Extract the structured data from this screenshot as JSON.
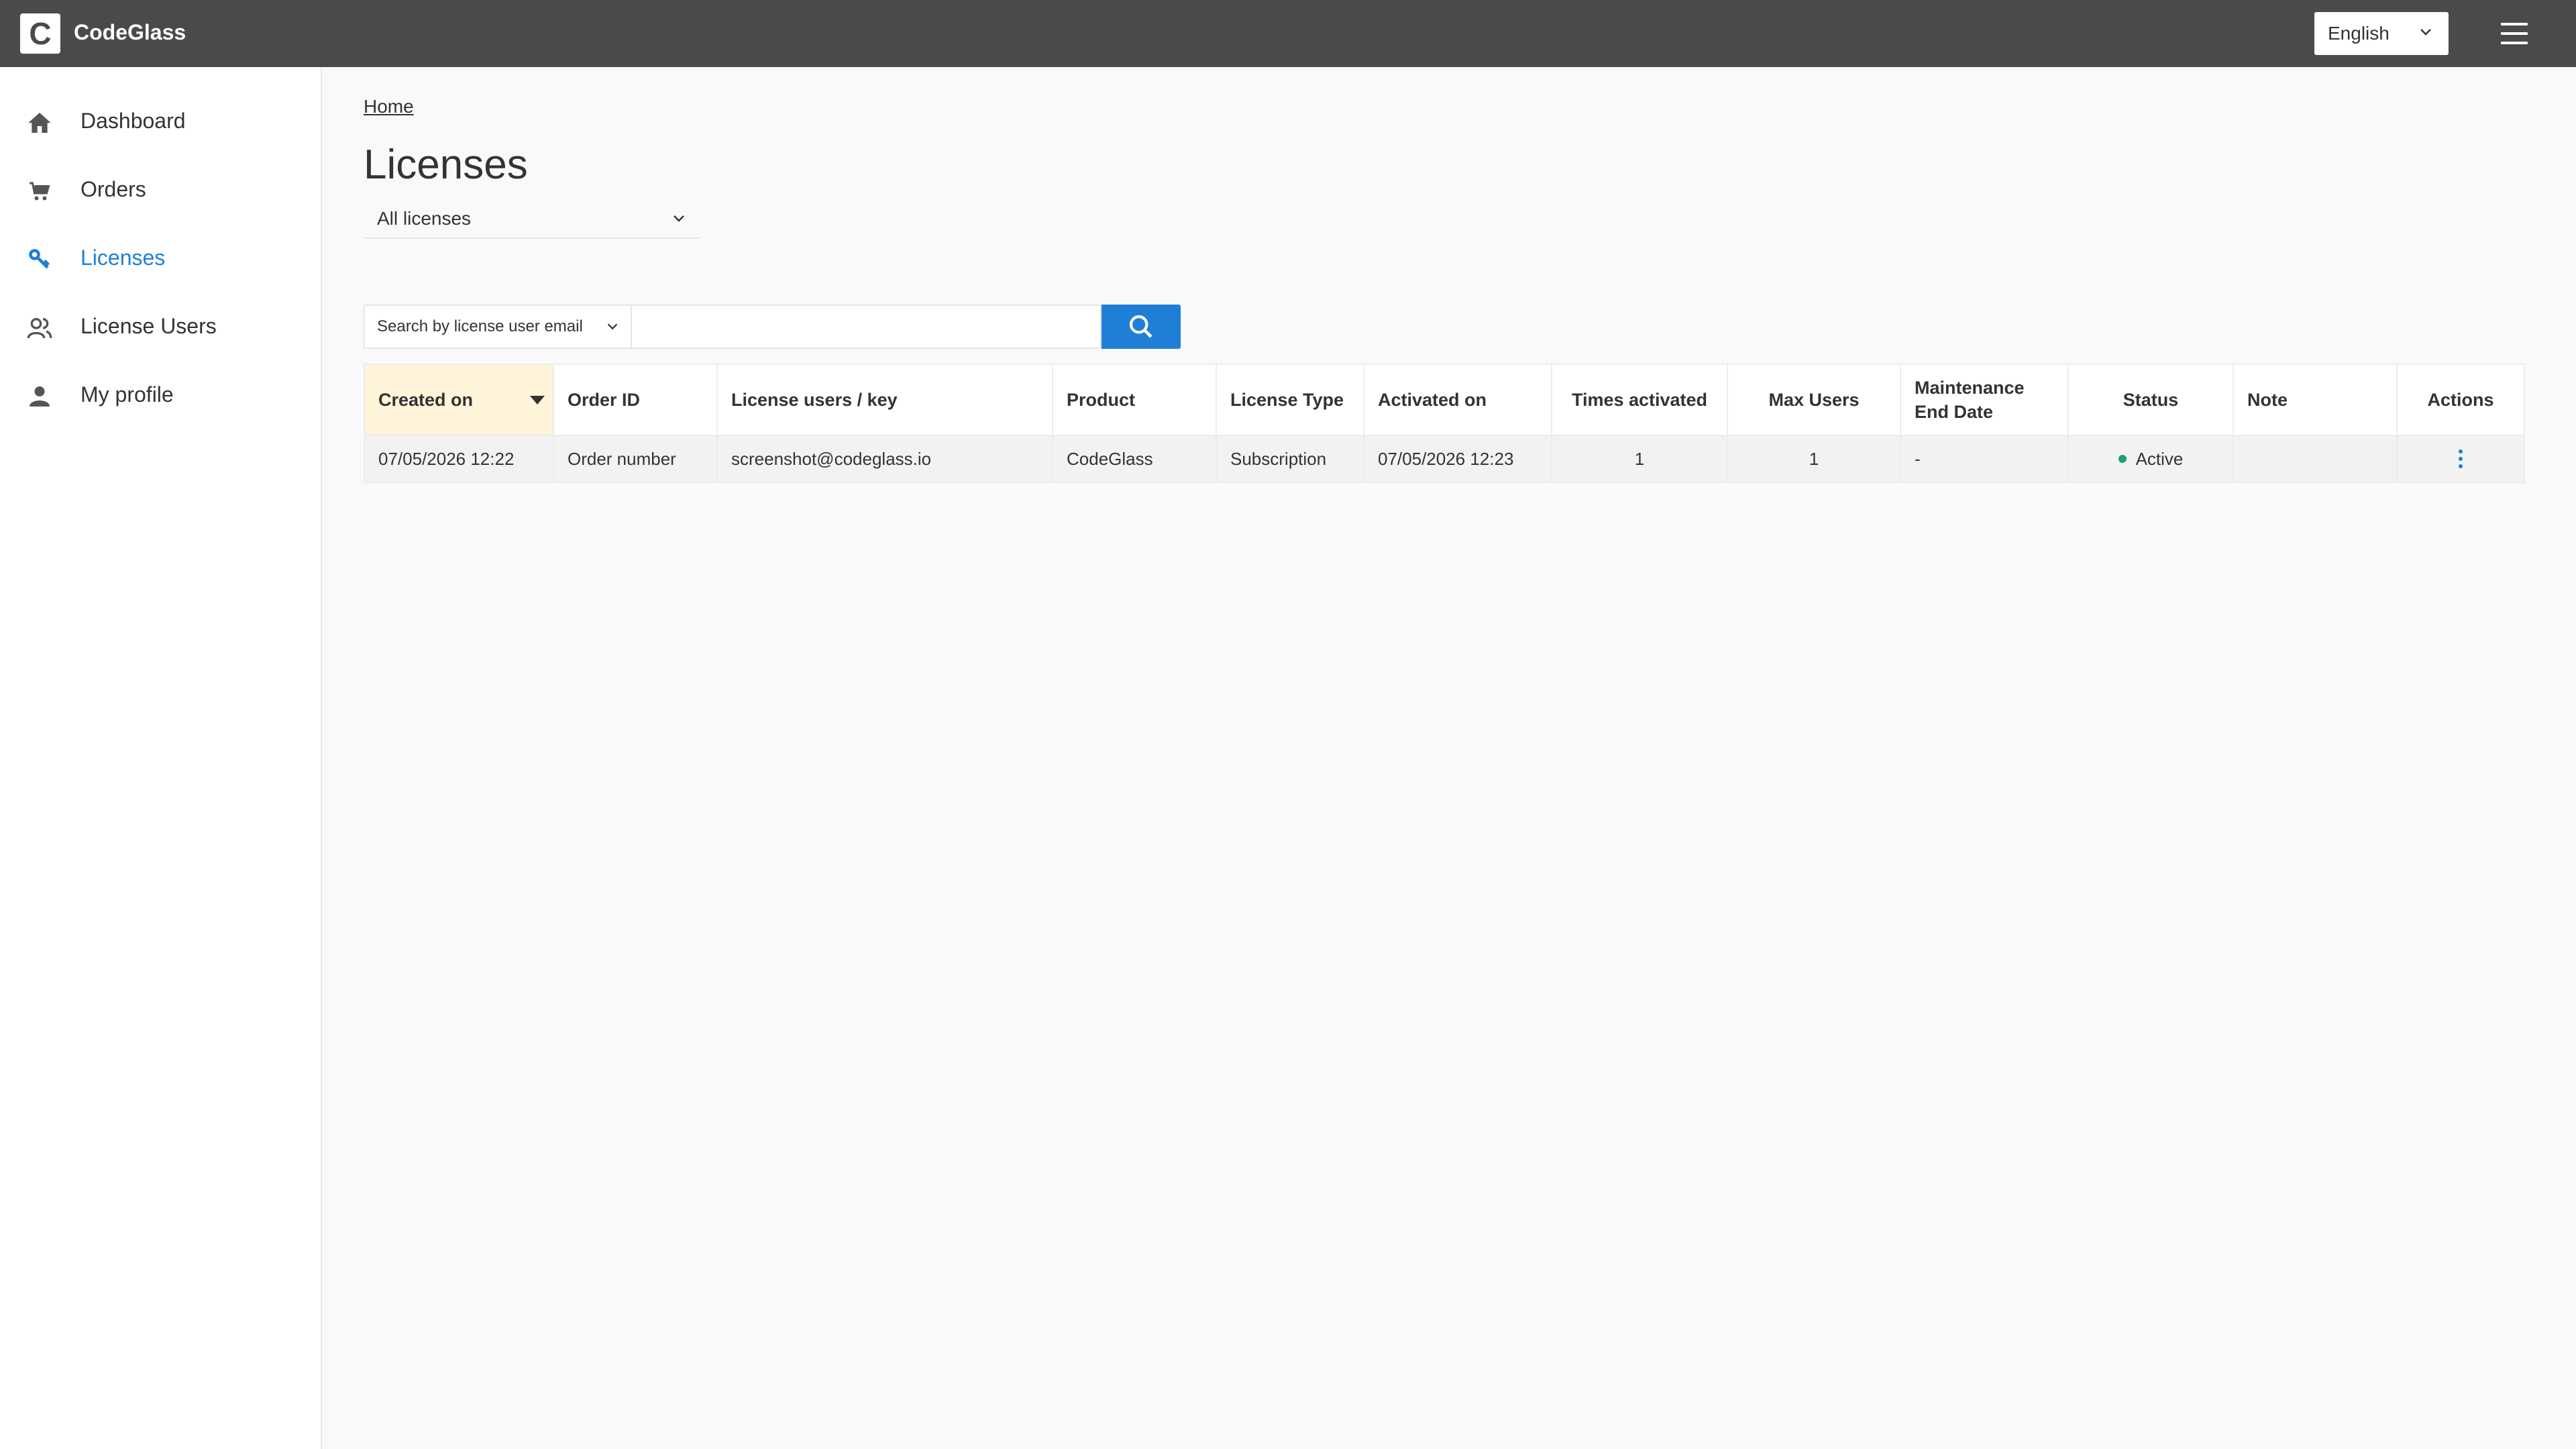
{
  "app": {
    "brand_initial": "C",
    "brand_name": "CodeGlass",
    "language": "English"
  },
  "sidebar": {
    "items": [
      {
        "label": "Dashboard",
        "icon": "home-icon"
      },
      {
        "label": "Orders",
        "icon": "cart-icon"
      },
      {
        "label": "Licenses",
        "icon": "key-icon",
        "active": true
      },
      {
        "label": "License Users",
        "icon": "users-icon"
      },
      {
        "label": "My profile",
        "icon": "person-icon"
      }
    ]
  },
  "main": {
    "breadcrumb": "Home",
    "title": "Licenses",
    "filter": "All licenses",
    "search": {
      "type_label": "Search by license user email",
      "value": "",
      "placeholder": ""
    }
  },
  "table": {
    "headers": {
      "created_on": "Created on",
      "order_id": "Order ID",
      "license_users": "License users / key",
      "product": "Product",
      "license_type": "License Type",
      "activated_on": "Activated on",
      "times_activated": "Times activated",
      "max_users": "Max Users",
      "maintenance_line1": "Maintenance",
      "maintenance_line2": "End Date",
      "status": "Status",
      "note": "Note",
      "actions": "Actions"
    },
    "rows": [
      {
        "created_on": "07/05/2026 12:22",
        "order_id": "Order number",
        "license_users": "screenshot@codeglass.io",
        "product": "CodeGlass",
        "license_type": "Subscription",
        "activated_on": "07/05/2026 12:23",
        "times_activated": "1",
        "max_users": "1",
        "maintenance_end": "-",
        "status": "Active",
        "note": ""
      }
    ]
  },
  "colors": {
    "topbar": "#4a4a4a",
    "accent": "#1f7fd6",
    "sorted_header": "#fff3d9",
    "status_active": "#1aa36b"
  }
}
